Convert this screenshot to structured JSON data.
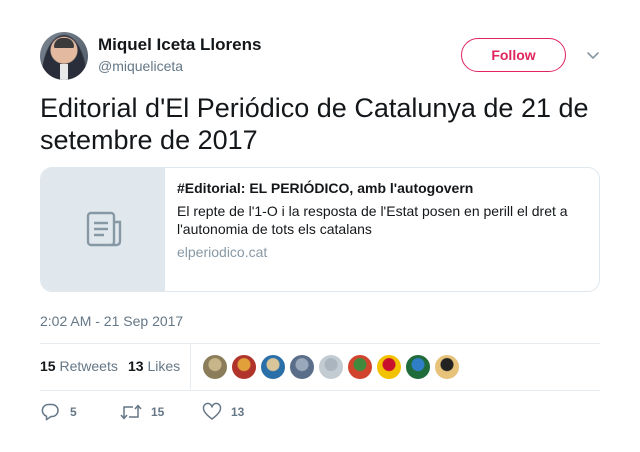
{
  "author": {
    "name": "Miquel Iceta Llorens",
    "handle": "@miqueliceta",
    "follow_label": "Follow"
  },
  "tweet": {
    "text": "Editorial d'El Periódico de Catalunya de 21 de setembre de 2017",
    "timestamp": "2:02 AM - 21 Sep 2017"
  },
  "card": {
    "icon": "document-icon",
    "title": "#Editorial: EL PERIÓDICO, amb l'autogovern",
    "description": "El repte de l'1-O i la resposta de l'Estat posen en perill el dret a l'autonomia de tots els catalans",
    "domain": "elperiodico.cat"
  },
  "stats": {
    "retweets_count": "15",
    "retweets_label": "Retweets",
    "likes_count": "13",
    "likes_label": "Likes"
  },
  "likers": [
    {
      "colors": [
        "#8b7d5a",
        "#c9b58a"
      ]
    },
    {
      "colors": [
        "#b0342c",
        "#e2a03b"
      ]
    },
    {
      "colors": [
        "#2b6fa8",
        "#d9c59a"
      ]
    },
    {
      "colors": [
        "#5a6e8a",
        "#9aa8bb"
      ]
    },
    {
      "colors": [
        "#c4ccd3",
        "#aab5bf"
      ]
    },
    {
      "colors": [
        "#d1452f",
        "#3f8a3c"
      ]
    },
    {
      "colors": [
        "#f2c200",
        "#c8102e"
      ]
    },
    {
      "colors": [
        "#1f6b3a",
        "#2f7fc8"
      ]
    },
    {
      "colors": [
        "#e6c27a",
        "#222222"
      ]
    }
  ],
  "actions": {
    "reply_count": "5",
    "retweet_count": "15",
    "like_count": "13"
  },
  "colors": {
    "accent": "#e0245e",
    "secondary_text": "#657786",
    "border": "#e1e8ed"
  }
}
